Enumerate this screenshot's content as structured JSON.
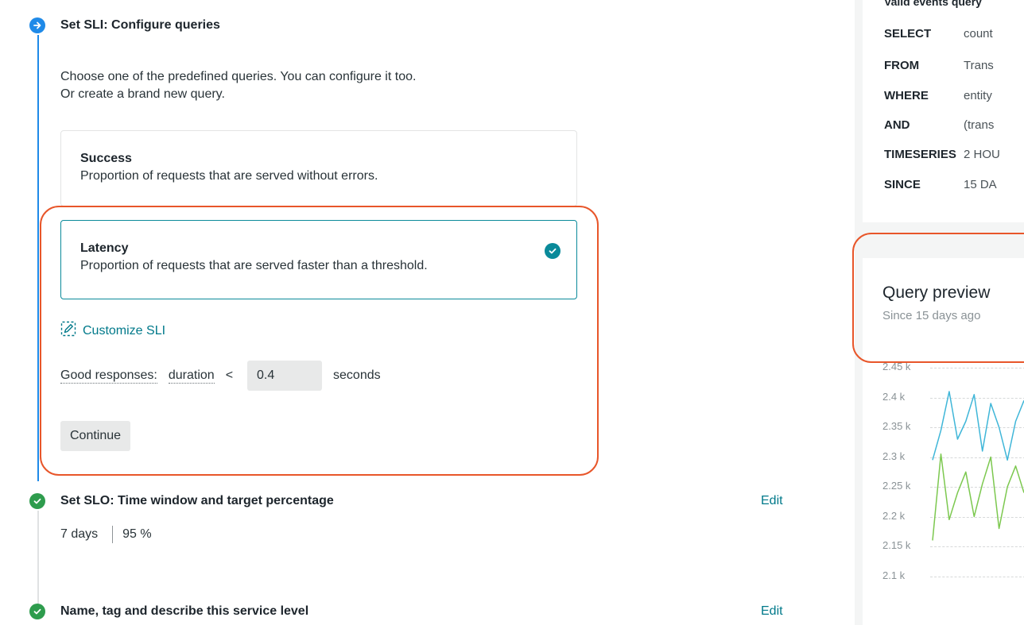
{
  "steps": {
    "sli": {
      "title": "Set SLI: Configure queries",
      "intro_line1": "Choose one of the predefined queries. You can configure it too.",
      "intro_line2": "Or create a brand new query.",
      "options": [
        {
          "title": "Success",
          "description": "Proportion of requests that are served without errors.",
          "selected": false
        },
        {
          "title": "Latency",
          "description": "Proportion of requests that are served faster than a threshold.",
          "selected": true
        }
      ],
      "customize_label": "Customize SLI",
      "good_responses_label": "Good responses:",
      "metric": "duration",
      "operator": "<",
      "threshold": "0.4",
      "unit": "seconds",
      "continue_label": "Continue"
    },
    "slo": {
      "title": "Set SLO: Time window and target percentage",
      "edit_label": "Edit",
      "time_window": "7 days",
      "target": "95 %"
    },
    "name": {
      "title": "Name, tag and describe this service level",
      "edit_label": "Edit"
    }
  },
  "query": {
    "label": "Valid events query",
    "rows": [
      {
        "keyword": "SELECT",
        "value": "count"
      },
      {
        "keyword": "FROM",
        "value": "Trans"
      },
      {
        "keyword": "WHERE",
        "value": "entity"
      },
      {
        "keyword": "AND",
        "value": "(trans"
      },
      {
        "keyword": "TIMESERIES",
        "value": "2 HOU"
      },
      {
        "keyword": "SINCE",
        "value": "15 DA"
      }
    ]
  },
  "preview": {
    "title": "Query preview",
    "subtitle": "Since 15 days ago"
  },
  "chart_data": {
    "type": "line",
    "y_ticks": [
      "2.45 k",
      "2.4 k",
      "2.35 k",
      "2.3 k",
      "2.25 k",
      "2.2 k",
      "2.15 k",
      "2.1 k"
    ],
    "ylim": [
      2100,
      2450
    ],
    "grid": true,
    "series": [
      {
        "color": "#3fb6d8",
        "values": [
          2295,
          2345,
          2410,
          2330,
          2360,
          2405,
          2310,
          2390,
          2350,
          2295,
          2360,
          2395
        ]
      },
      {
        "color": "#7cc84f",
        "values": [
          2160,
          2305,
          2195,
          2240,
          2275,
          2200,
          2255,
          2300,
          2180,
          2250,
          2285,
          2240
        ]
      }
    ]
  },
  "colors": {
    "accent": "#00798a",
    "highlight": "#e8562a",
    "step_active": "#1f8ae8",
    "step_done": "#2e9c4d"
  }
}
